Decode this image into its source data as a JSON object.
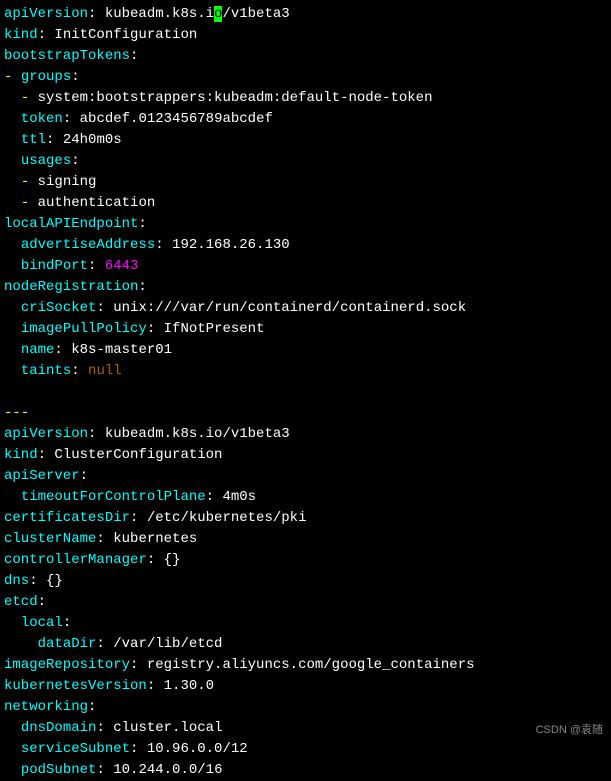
{
  "lines": {
    "l1": {
      "k": "apiVersion",
      "v1": "kubeadm.k8s.i",
      "cursor": "o",
      "v2": "/v1beta3"
    },
    "l2": {
      "k": "kind",
      "v": "InitConfiguration"
    },
    "l3": {
      "k": "bootstrapTokens"
    },
    "l4": {
      "dash": "- ",
      "k": "groups"
    },
    "l5": {
      "dash": "- ",
      "v": "system:bootstrappers:kubeadm:default-node-token"
    },
    "l6": {
      "k": "token",
      "v": "abcdef.0123456789abcdef"
    },
    "l7": {
      "k": "ttl",
      "v": "24h0m0s"
    },
    "l8": {
      "k": "usages"
    },
    "l9": {
      "dash": "- ",
      "v": "signing"
    },
    "l10": {
      "dash": "- ",
      "v": "authentication"
    },
    "l11": {
      "k": "localAPIEndpoint"
    },
    "l12": {
      "k": "advertiseAddress",
      "v": "192.168.26.130"
    },
    "l13": {
      "k": "bindPort",
      "v": "6443"
    },
    "l14": {
      "k": "nodeRegistration"
    },
    "l15": {
      "k": "criSocket",
      "v": "unix:///var/run/containerd/containerd.sock"
    },
    "l16": {
      "k": "imagePullPolicy",
      "v": "IfNotPresent"
    },
    "l17": {
      "k": "name",
      "v": "k8s-master01"
    },
    "l18": {
      "k": "taints",
      "v": "null"
    },
    "l19": {
      "sep": "---"
    },
    "l20": {
      "k": "apiVersion",
      "v": "kubeadm.k8s.io/v1beta3"
    },
    "l21": {
      "k": "kind",
      "v": "ClusterConfiguration"
    },
    "l22": {
      "k": "apiServer"
    },
    "l23": {
      "k": "timeoutForControlPlane",
      "v": "4m0s"
    },
    "l24": {
      "k": "certificatesDir",
      "v": "/etc/kubernetes/pki"
    },
    "l25": {
      "k": "clusterName",
      "v": "kubernetes"
    },
    "l26": {
      "k": "controllerManager",
      "v": "{}"
    },
    "l27": {
      "k": "dns",
      "v": "{}"
    },
    "l28": {
      "k": "etcd"
    },
    "l29": {
      "k": "local"
    },
    "l30": {
      "k": "dataDir",
      "v": "/var/lib/etcd"
    },
    "l31": {
      "k": "imageRepository",
      "v": "registry.aliyuncs.com/google_containers"
    },
    "l32": {
      "k": "kubernetesVersion",
      "v": "1.30.0"
    },
    "l33": {
      "k": "networking"
    },
    "l34": {
      "k": "dnsDomain",
      "v": "cluster.local"
    },
    "l35": {
      "k": "serviceSubnet",
      "v": "10.96.0.0/12"
    },
    "l36": {
      "k": "podSubnet",
      "v": "10.244.0.0/16"
    }
  },
  "watermark": "CSDN @袁随"
}
